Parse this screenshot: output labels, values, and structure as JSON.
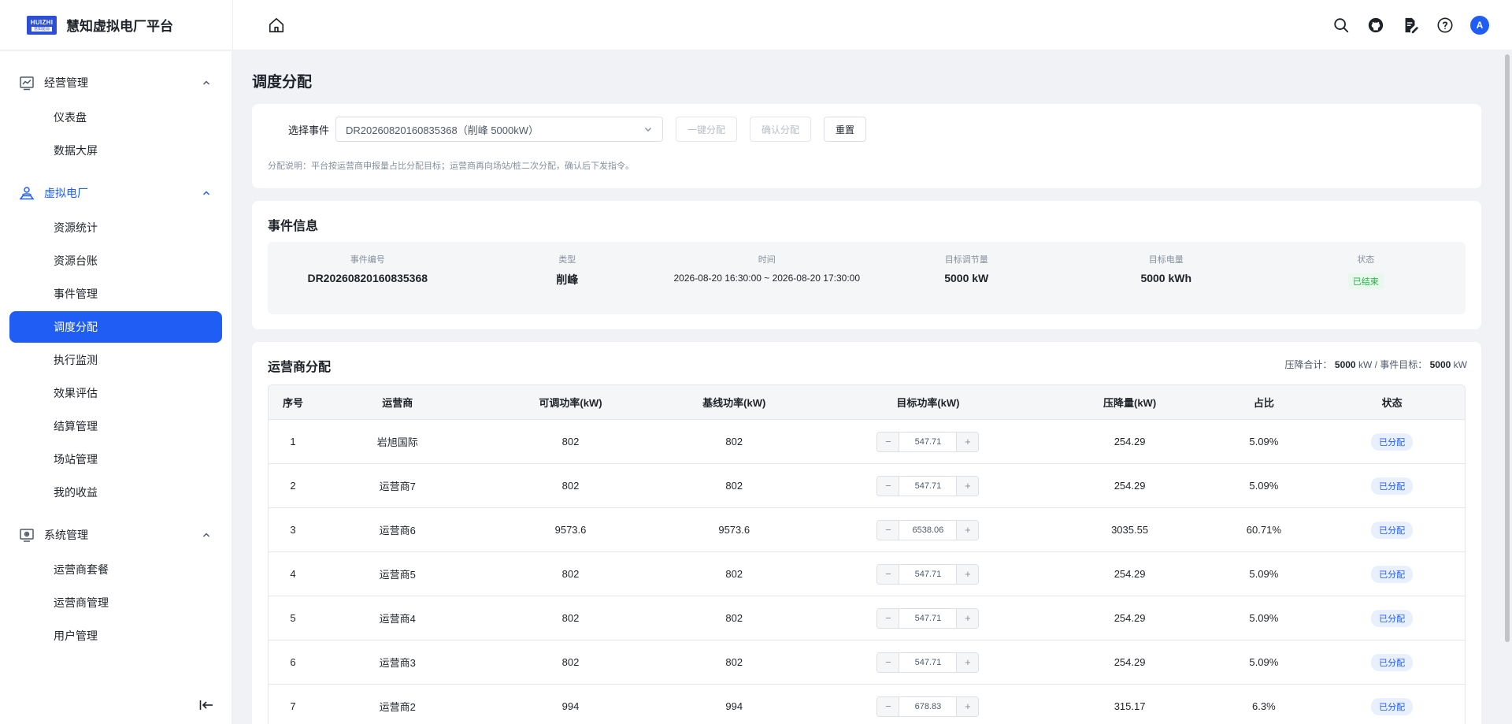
{
  "header": {
    "logo_top": "HUIZHI",
    "logo_bottom": "慧知能源",
    "title": "慧知虚拟电厂平台",
    "avatar_letter": "A"
  },
  "sidebar": {
    "groups": [
      {
        "label": "经营管理",
        "items": [
          "仪表盘",
          "数据大屏"
        ]
      },
      {
        "label": "虚拟电厂",
        "items": [
          "资源统计",
          "资源台账",
          "事件管理",
          "调度分配",
          "执行监测",
          "效果评估",
          "结算管理",
          "场站管理",
          "我的收益"
        ]
      },
      {
        "label": "系统管理",
        "items": [
          "运营商套餐",
          "运营商管理",
          "用户管理"
        ]
      }
    ],
    "active_item": "调度分配",
    "active_group": "虚拟电厂"
  },
  "page": {
    "title": "调度分配",
    "filter_label": "选择事件",
    "event_select": "DR20260820160835368（削峰 5000kW）",
    "btn_one_click": "一键分配",
    "btn_confirm": "确认分配",
    "btn_reset": "重置",
    "note": "分配说明：平台按运营商申报量占比分配目标；运营商再向场站/桩二次分配，确认后下发指令。"
  },
  "event_info": {
    "title": "事件信息",
    "labels": [
      "事件编号",
      "类型",
      "时间",
      "目标调节量",
      "目标电量",
      "状态"
    ],
    "event_no": "DR20260820160835368",
    "type": "削峰",
    "time": "2026-08-20 16:30:00 ~ 2026-08-20 17:30:00",
    "target_adjust": "5000 kW",
    "target_energy": "5000 kWh",
    "status": "已结束"
  },
  "allocation": {
    "title": "运营商分配",
    "summary_label1": "压降合计：",
    "summary_val1": "5000",
    "summary_unit1": "kW / 事件目标：",
    "summary_val2": "5000",
    "summary_unit2": "kW",
    "columns": [
      "序号",
      "运营商",
      "可调功率(kW)",
      "基线功率(kW)",
      "目标功率(kW)",
      "压降量(kW)",
      "占比",
      "状态"
    ],
    "rows": [
      {
        "no": "1",
        "name": "岩旭国际",
        "adjustable": "802",
        "baseline": "802",
        "target": "547.71",
        "reduction": "254.29",
        "ratio": "5.09%",
        "status": "已分配"
      },
      {
        "no": "2",
        "name": "运营商7",
        "adjustable": "802",
        "baseline": "802",
        "target": "547.71",
        "reduction": "254.29",
        "ratio": "5.09%",
        "status": "已分配"
      },
      {
        "no": "3",
        "name": "运营商6",
        "adjustable": "9573.6",
        "baseline": "9573.6",
        "target": "6538.06",
        "reduction": "3035.55",
        "ratio": "60.71%",
        "status": "已分配"
      },
      {
        "no": "4",
        "name": "运营商5",
        "adjustable": "802",
        "baseline": "802",
        "target": "547.71",
        "reduction": "254.29",
        "ratio": "5.09%",
        "status": "已分配"
      },
      {
        "no": "5",
        "name": "运营商4",
        "adjustable": "802",
        "baseline": "802",
        "target": "547.71",
        "reduction": "254.29",
        "ratio": "5.09%",
        "status": "已分配"
      },
      {
        "no": "6",
        "name": "运营商3",
        "adjustable": "802",
        "baseline": "802",
        "target": "547.71",
        "reduction": "254.29",
        "ratio": "5.09%",
        "status": "已分配"
      },
      {
        "no": "7",
        "name": "运营商2",
        "adjustable": "994",
        "baseline": "994",
        "target": "678.83",
        "reduction": "315.17",
        "ratio": "6.3%",
        "status": "已分配"
      }
    ]
  }
}
